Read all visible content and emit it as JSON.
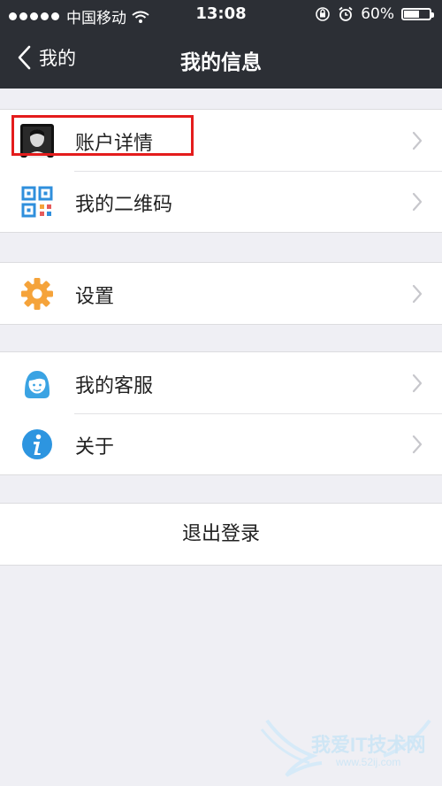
{
  "status_bar": {
    "carrier": "中国移动",
    "time": "13:08",
    "battery_percent_label": "60%",
    "battery_level": 0.6,
    "icons": [
      "signal-dots-icon",
      "wifi-icon",
      "orientation-lock-icon",
      "alarm-icon",
      "battery-icon"
    ]
  },
  "nav": {
    "back_label": "我的",
    "title": "我的信息"
  },
  "groups": [
    {
      "items": [
        {
          "label": "账户详情",
          "icon": "avatar-icon",
          "highlighted": true
        },
        {
          "label": "我的二维码",
          "icon": "qr-code-icon"
        }
      ]
    },
    {
      "items": [
        {
          "label": "设置",
          "icon": "gear-icon"
        }
      ]
    },
    {
      "items": [
        {
          "label": "我的客服",
          "icon": "customer-service-icon"
        },
        {
          "label": "关于",
          "icon": "info-icon"
        }
      ]
    }
  ],
  "logout_label": "退出登录",
  "watermark": {
    "text": "我爱IT技术网",
    "url": "www.52ij.com"
  },
  "colors": {
    "nav_background": "#2c2f35",
    "page_background": "#efeff4",
    "highlight": "#e41c1c",
    "qr_blue": "#2f8fdc",
    "gear_orange": "#f5a33a",
    "service_blue": "#3aa3e3",
    "info_blue": "#2d95e0"
  }
}
